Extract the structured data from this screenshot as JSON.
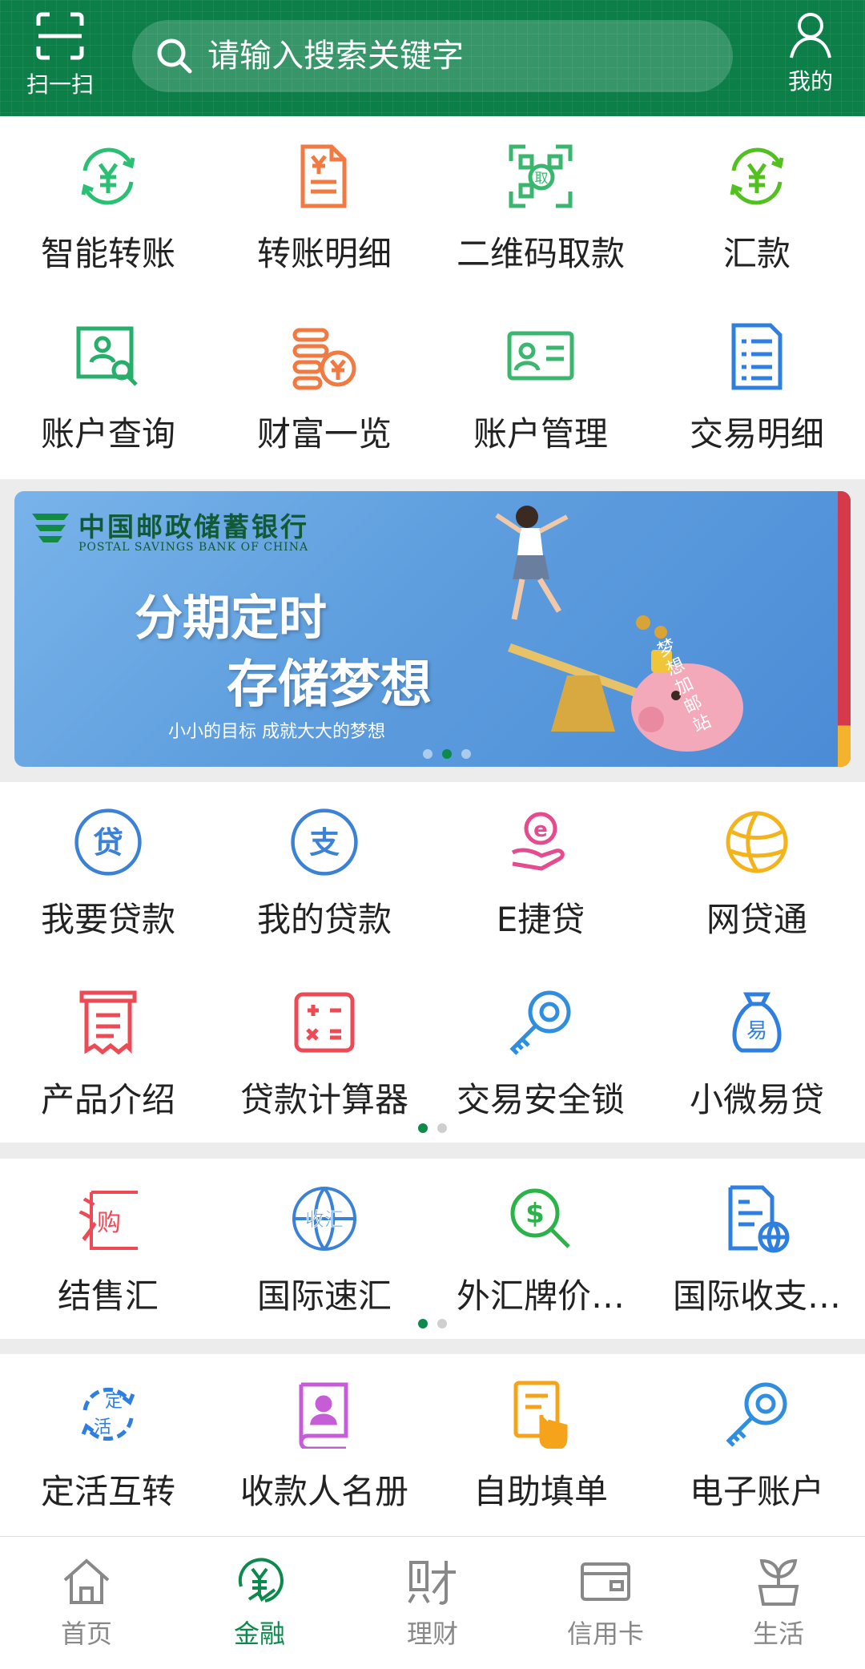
{
  "header": {
    "scan_label": "扫一扫",
    "search_placeholder": "请输入搜索关键字",
    "mine_label": "我的"
  },
  "quick_services": [
    {
      "label": "智能转账",
      "icon": "smart-transfer-icon",
      "color": "#2bbf73"
    },
    {
      "label": "转账明细",
      "icon": "transfer-detail-icon",
      "color": "#f07a42"
    },
    {
      "label": "二维码取款",
      "icon": "qr-withdraw-icon",
      "color": "#3ab66e"
    },
    {
      "label": "汇款",
      "icon": "remittance-icon",
      "color": "#52c11f"
    },
    {
      "label": "账户查询",
      "icon": "account-query-icon",
      "color": "#27ae6b"
    },
    {
      "label": "财富一览",
      "icon": "wealth-overview-icon",
      "color": "#f07a42"
    },
    {
      "label": "账户管理",
      "icon": "account-manage-icon",
      "color": "#3ab66e"
    },
    {
      "label": "交易明细",
      "icon": "transaction-detail-icon",
      "color": "#2f7fe0"
    }
  ],
  "banner": {
    "bank_name_cn": "中国邮政储蓄银行",
    "bank_name_en": "POSTAL SAVINGS BANK OF CHINA",
    "headline_1": "分期定时",
    "headline_2": "存储梦想",
    "slogan": "小小的目标   成就大大的梦想",
    "side_text": "梦想加邮站",
    "active_slide": 2,
    "slide_count": 3
  },
  "loan_services": [
    {
      "label": "我要贷款",
      "icon": "loan-apply-icon",
      "color": "#3b82d6"
    },
    {
      "label": "我的贷款",
      "icon": "my-loan-icon",
      "color": "#3b82d6"
    },
    {
      "label": "E捷贷",
      "icon": "e-loan-icon",
      "color": "#e64a8f"
    },
    {
      "label": "网贷通",
      "icon": "online-loan-icon",
      "color": "#f5b31b"
    },
    {
      "label": "产品介绍",
      "icon": "product-intro-icon",
      "color": "#ee4a56"
    },
    {
      "label": "贷款计算器",
      "icon": "loan-calculator-icon",
      "color": "#ee4a56"
    },
    {
      "label": "交易安全锁",
      "icon": "security-lock-icon",
      "color": "#2f8ee0"
    },
    {
      "label": "小微易贷",
      "icon": "micro-loan-icon",
      "color": "#2f7fe0"
    }
  ],
  "fx_services": [
    {
      "label": "结售汇",
      "icon": "fx-settlement-icon",
      "color": "#ee4a56"
    },
    {
      "label": "国际速汇",
      "icon": "intl-remit-icon",
      "color": "#3b82d6"
    },
    {
      "label": "外汇牌价…",
      "icon": "fx-rate-icon",
      "color": "#2bb34a"
    },
    {
      "label": "国际收支…",
      "icon": "intl-balance-icon",
      "color": "#2f7fe0"
    }
  ],
  "other_services": [
    {
      "label": "定活互转",
      "icon": "fixed-demand-icon",
      "color": "#2f7fe0"
    },
    {
      "label": "收款人名册",
      "icon": "payee-book-icon",
      "color": "#c45dd6"
    },
    {
      "label": "自助填单",
      "icon": "self-fill-icon",
      "color": "#f5a31b"
    },
    {
      "label": "电子账户",
      "icon": "e-account-icon",
      "color": "#2f8ee0"
    }
  ],
  "tabbar": [
    {
      "label": "首页",
      "icon": "home-icon",
      "active": false
    },
    {
      "label": "金融",
      "icon": "finance-icon",
      "active": true
    },
    {
      "label": "理财",
      "icon": "wealth-icon",
      "active": false
    },
    {
      "label": "信用卡",
      "icon": "credit-card-icon",
      "active": false
    },
    {
      "label": "生活",
      "icon": "life-icon",
      "active": false
    }
  ],
  "colors": {
    "brand": "#0c7f48",
    "active_tab": "#0c8a4c"
  }
}
